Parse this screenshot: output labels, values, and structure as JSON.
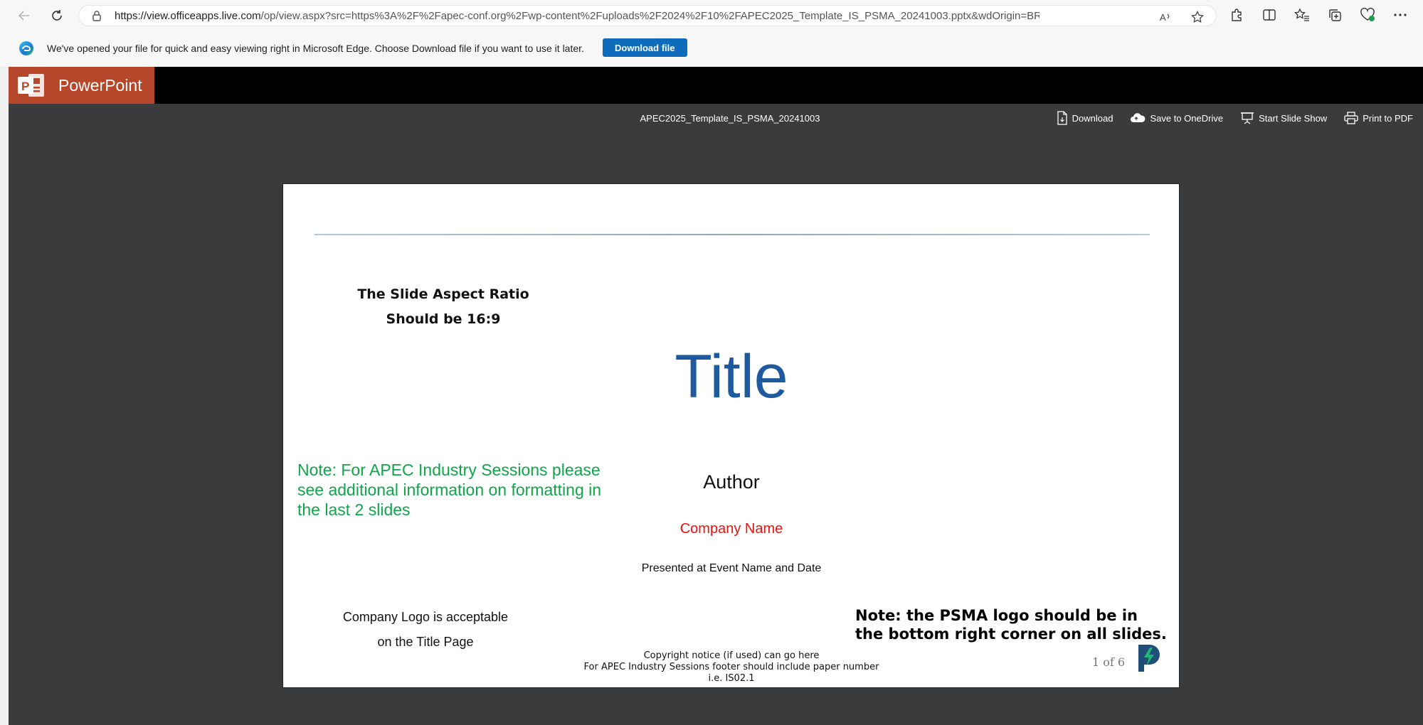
{
  "browser": {
    "url_host": "https://view.officeapps.live.com",
    "url_path": "/op/view.aspx?src=https%3A%2F%2Fapec-conf.org%2Fwp-content%2Fuploads%2F2024%2F10%2FAPEC2025_Template_IS_PSMA_20241003.pptx&wdOrigin=BROWSELINK",
    "icons": [
      "back-icon",
      "refresh-icon",
      "lock-icon",
      "read-aloud-icon",
      "favorite-star-icon",
      "extensions-icon",
      "split-screen-icon",
      "favorites-icon",
      "collections-icon",
      "browser-essentials-icon",
      "more-icon"
    ]
  },
  "infobar": {
    "message": "We've opened your file for quick and easy viewing right in Microsoft Edge. Choose Download file if you want to use it later.",
    "download_label": "Download file"
  },
  "app": {
    "name": "PowerPoint",
    "brand_color": "#b7472a"
  },
  "viewer": {
    "doc_title": "APEC2025_Template_IS_PSMA_20241003",
    "actions": {
      "download": "Download",
      "save_onedrive": "Save to OneDrive",
      "slideshow": "Start Slide Show",
      "print": "Print to PDF"
    }
  },
  "slide": {
    "aspect_line1": "The Slide Aspect Ratio",
    "aspect_line2": "Should be 16:9",
    "title": "Title",
    "industry_note": "Note: For APEC Industry Sessions please see additional information on formatting in the last 2 slides",
    "author": "Author",
    "company": "Company Name",
    "presented": "Presented at Event Name and Date",
    "logo_line1": "Company Logo is acceptable",
    "logo_line2": "on the Title Page",
    "psma_note": "Note: the PSMA logo should be in the bottom right corner on all slides.",
    "copyright_line1": "Copyright notice (if used) can go here",
    "copyright_line2": "For APEC Industry Sessions footer should include paper number",
    "copyright_line3": "i.e. IS02.1",
    "page": "1 of 6",
    "colors": {
      "title": "#1f5aa0",
      "note_green": "#10a54a",
      "company_red": "#ee1111"
    }
  }
}
